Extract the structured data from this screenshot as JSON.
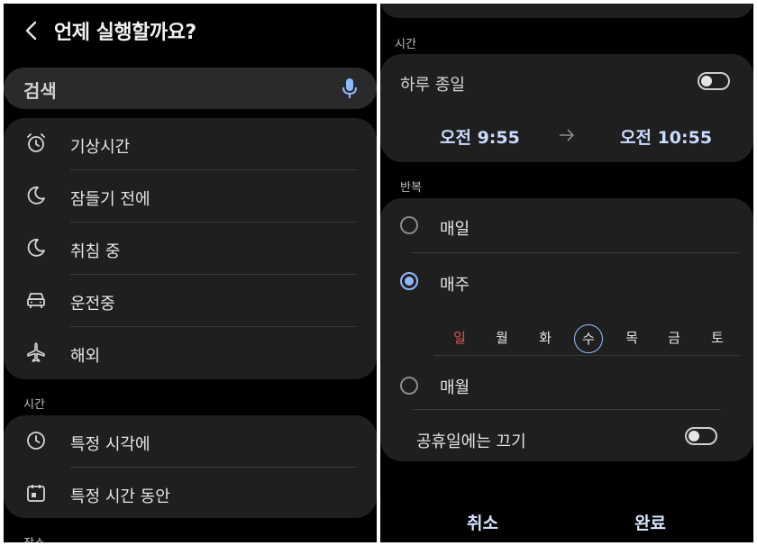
{
  "left": {
    "header": {
      "title": "언제 실행할까요?"
    },
    "search": {
      "placeholder": "검색"
    },
    "list1": [
      {
        "label": "기상시간",
        "icon": "alarm-clock-icon"
      },
      {
        "label": "잠들기 전에",
        "icon": "moon-icon"
      },
      {
        "label": "취침 중",
        "icon": "moon-icon"
      },
      {
        "label": "운전중",
        "icon": "car-icon"
      },
      {
        "label": "해외",
        "icon": "airplane-icon"
      }
    ],
    "section_time": "시간",
    "list2": [
      {
        "label": "특정 시각에",
        "icon": "clock-icon"
      },
      {
        "label": "특정 시간 동안",
        "icon": "calendar-timer-icon"
      }
    ],
    "section_place": "장소"
  },
  "right": {
    "section_time": "시간",
    "all_day": {
      "label": "하루 종일",
      "on": false
    },
    "start_time": "오전 9:55",
    "end_time": "오전 10:55",
    "section_repeat": "반복",
    "options": [
      {
        "label": "매일",
        "selected": false
      },
      {
        "label": "매주",
        "selected": true
      },
      {
        "label": "매월",
        "selected": false
      }
    ],
    "days": [
      "일",
      "월",
      "화",
      "수",
      "목",
      "금",
      "토"
    ],
    "selected_day": "수",
    "holiday_off": {
      "label": "공휴일에는 끄기",
      "on": false
    },
    "buttons": {
      "cancel": "취소",
      "done": "완료"
    }
  },
  "colors": {
    "background": "#000000",
    "card": "#1f1f1f",
    "accent": "#8fb8ff",
    "sunday": "#e5534b"
  }
}
